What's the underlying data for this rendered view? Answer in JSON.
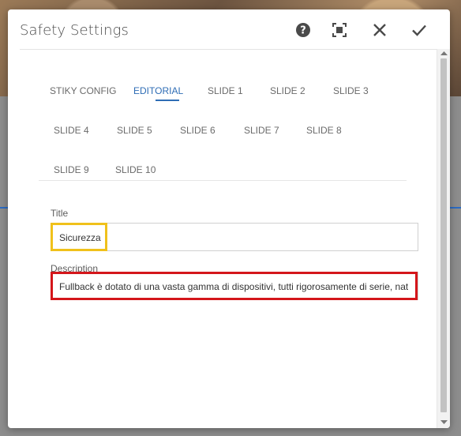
{
  "dialog": {
    "title": "Safety Settings",
    "actions": {
      "help_icon": "help-icon",
      "fullscreen_icon": "fullscreen-icon",
      "close_icon": "close-icon",
      "done_icon": "check-icon"
    }
  },
  "tabs": [
    {
      "label": "STIKY CONFIG",
      "active": false
    },
    {
      "label": "EDITORIAL",
      "active": true
    },
    {
      "label": "SLIDE 1",
      "active": false
    },
    {
      "label": "SLIDE 2",
      "active": false
    },
    {
      "label": "SLIDE 3",
      "active": false
    },
    {
      "label": "SLIDE 4",
      "active": false
    },
    {
      "label": "SLIDE 5",
      "active": false
    },
    {
      "label": "SLIDE 6",
      "active": false
    },
    {
      "label": "SLIDE 7",
      "active": false
    },
    {
      "label": "SLIDE 8",
      "active": false
    },
    {
      "label": "SLIDE 9",
      "active": false
    },
    {
      "label": "SLIDE 10",
      "active": false
    }
  ],
  "form": {
    "title_label": "Title",
    "title_value": "Sicurezza",
    "description_label": "Description",
    "description_value": "Fullback è dotato di una vasta gamma di dispositivi, tutti rigorosamente di serie, nati"
  },
  "colors": {
    "accent": "#2f6db5",
    "highlight_title": "#f0c11b",
    "highlight_description": "#d4161b"
  }
}
